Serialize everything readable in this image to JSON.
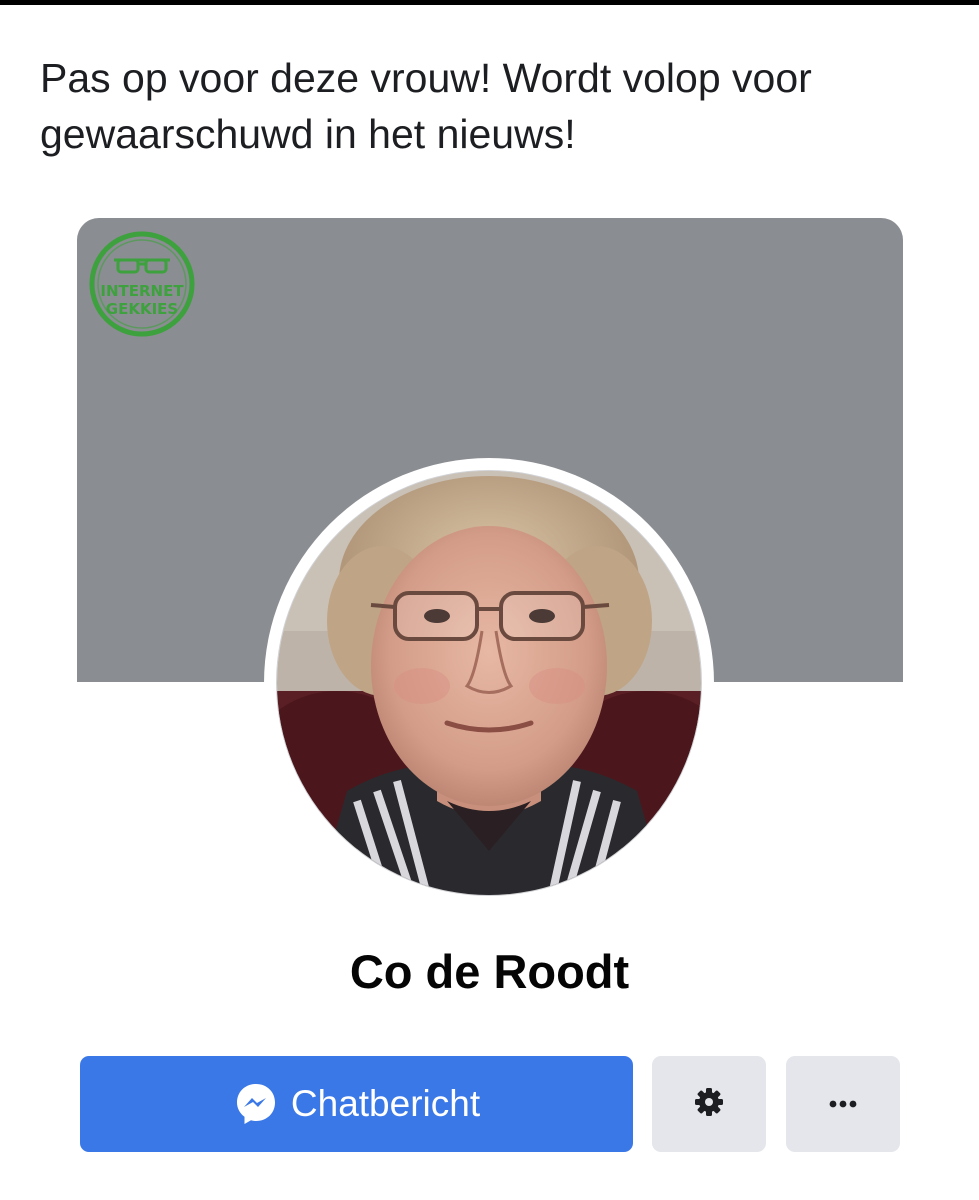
{
  "post": {
    "text": "Pas op voor deze vrouw! Wordt volop voor gewaarschuwd in het nieuws!"
  },
  "watermark": {
    "line1": "INTERNET",
    "line2": "GEKKIES",
    "color": "#3da13d"
  },
  "profile": {
    "name": "Co de Roodt",
    "cover_color": "#8a8d91"
  },
  "actions": {
    "message_label": "Chatbericht",
    "message_color": "#3b78e7",
    "settings_icon": "gear-icon",
    "more_icon": "more-dots-icon"
  }
}
